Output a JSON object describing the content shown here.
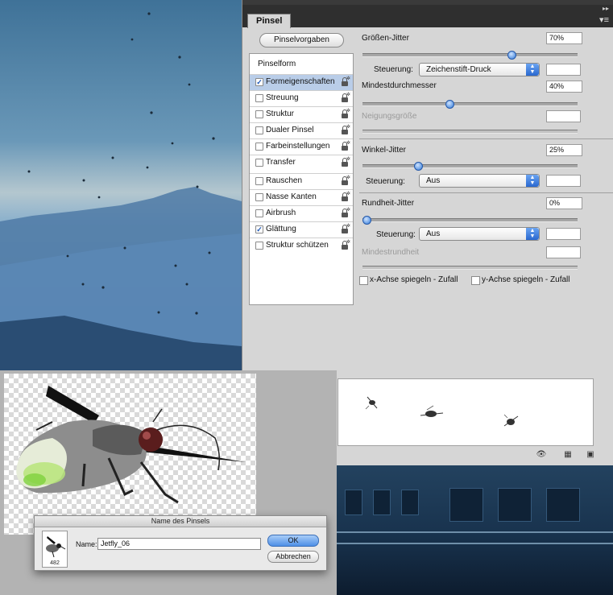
{
  "panel": {
    "tab_label": "Pinsel",
    "presets_button": "Pinselvorgaben",
    "brush_tip_heading": "Pinselform",
    "options": [
      {
        "label": "Formeigenschaften",
        "checked": true,
        "selected": true
      },
      {
        "label": "Streuung",
        "checked": false,
        "selected": false
      },
      {
        "label": "Struktur",
        "checked": false,
        "selected": false
      },
      {
        "label": "Dualer Pinsel",
        "checked": false,
        "selected": false
      },
      {
        "label": "Farbeinstellungen",
        "checked": false,
        "selected": false
      },
      {
        "label": "Transfer",
        "checked": false,
        "selected": false
      },
      {
        "label": "Rauschen",
        "checked": false,
        "selected": false
      },
      {
        "label": "Nasse Kanten",
        "checked": false,
        "selected": false
      },
      {
        "label": "Airbrush",
        "checked": false,
        "selected": false
      },
      {
        "label": "Glättung",
        "checked": true,
        "selected": false
      },
      {
        "label": "Struktur schützen",
        "checked": false,
        "selected": false
      }
    ],
    "settings": {
      "size_jitter": {
        "label": "Größen-Jitter",
        "value": "70%",
        "level": 0.7
      },
      "size_control": {
        "label": "Steuerung:",
        "value": "Zeichenstift-Druck"
      },
      "min_diameter": {
        "label": "Mindestdurchmesser",
        "value": "40%",
        "level": 0.4
      },
      "tilt_scale": {
        "label": "Neigungsgröße"
      },
      "angle_jitter": {
        "label": "Winkel-Jitter",
        "value": "25%",
        "level": 0.25
      },
      "angle_control": {
        "label": "Steuerung:",
        "value": "Aus"
      },
      "roundness_jitter": {
        "label": "Rundheit-Jitter",
        "value": "0%",
        "level": 0
      },
      "roundness_control": {
        "label": "Steuerung:",
        "value": "Aus"
      },
      "min_roundness": {
        "label": "Mindestrundheit"
      },
      "flip_x": {
        "label": "x-Achse spiegeln - Zufall",
        "checked": false
      },
      "flip_y": {
        "label": "y-Achse spiegeln - Zufall",
        "checked": false
      }
    }
  },
  "dialog": {
    "title": "Name des Pinsels",
    "brush_size": "482",
    "name_label": "Name:",
    "name_value": "Jetfly_06",
    "ok_label": "OK",
    "cancel_label": "Abbrechen"
  },
  "colors": {
    "selection": "#b9cde8",
    "accent_blue": "#2f78d8",
    "panel_bg": "#d6d6d6"
  }
}
